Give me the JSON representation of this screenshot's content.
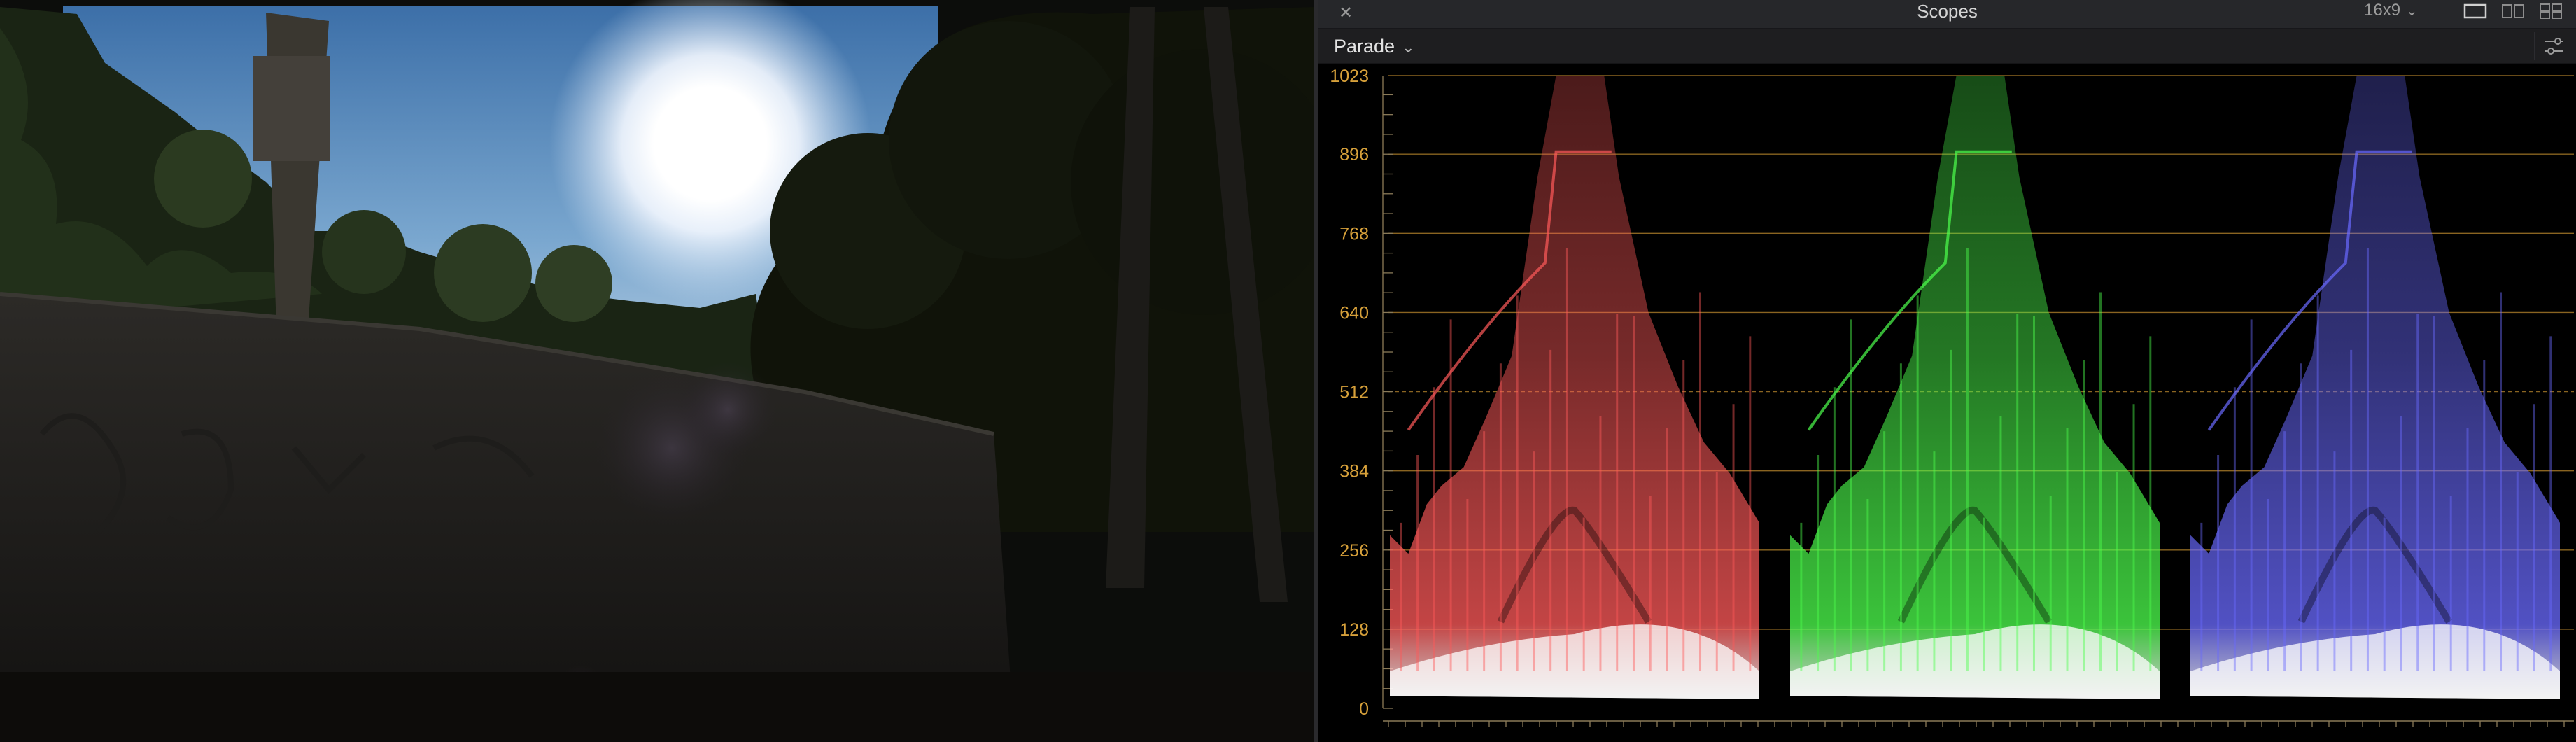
{
  "viewer": {
    "description_icon": "video-frame"
  },
  "scopes": {
    "title": "Scopes",
    "close_icon": "close-icon",
    "aspect": "16x9",
    "layout_icons": [
      "single-view-icon",
      "dual-view-icon",
      "quad-view-icon"
    ],
    "mode": "Parade",
    "settings_icon": "scope-settings-icon"
  },
  "colors": {
    "red_channel": "#ff5a5a",
    "green_channel": "#4dff4d",
    "blue_channel": "#6a6aff",
    "graticule": "#b8862c",
    "axis_label": "#d6a03a"
  },
  "chart_data": {
    "type": "parade",
    "series": [
      {
        "name": "R"
      },
      {
        "name": "G"
      },
      {
        "name": "B"
      }
    ],
    "y_ticks": [
      0,
      128,
      256,
      384,
      512,
      640,
      768,
      896,
      1023
    ],
    "ylim": [
      0,
      1023
    ]
  }
}
